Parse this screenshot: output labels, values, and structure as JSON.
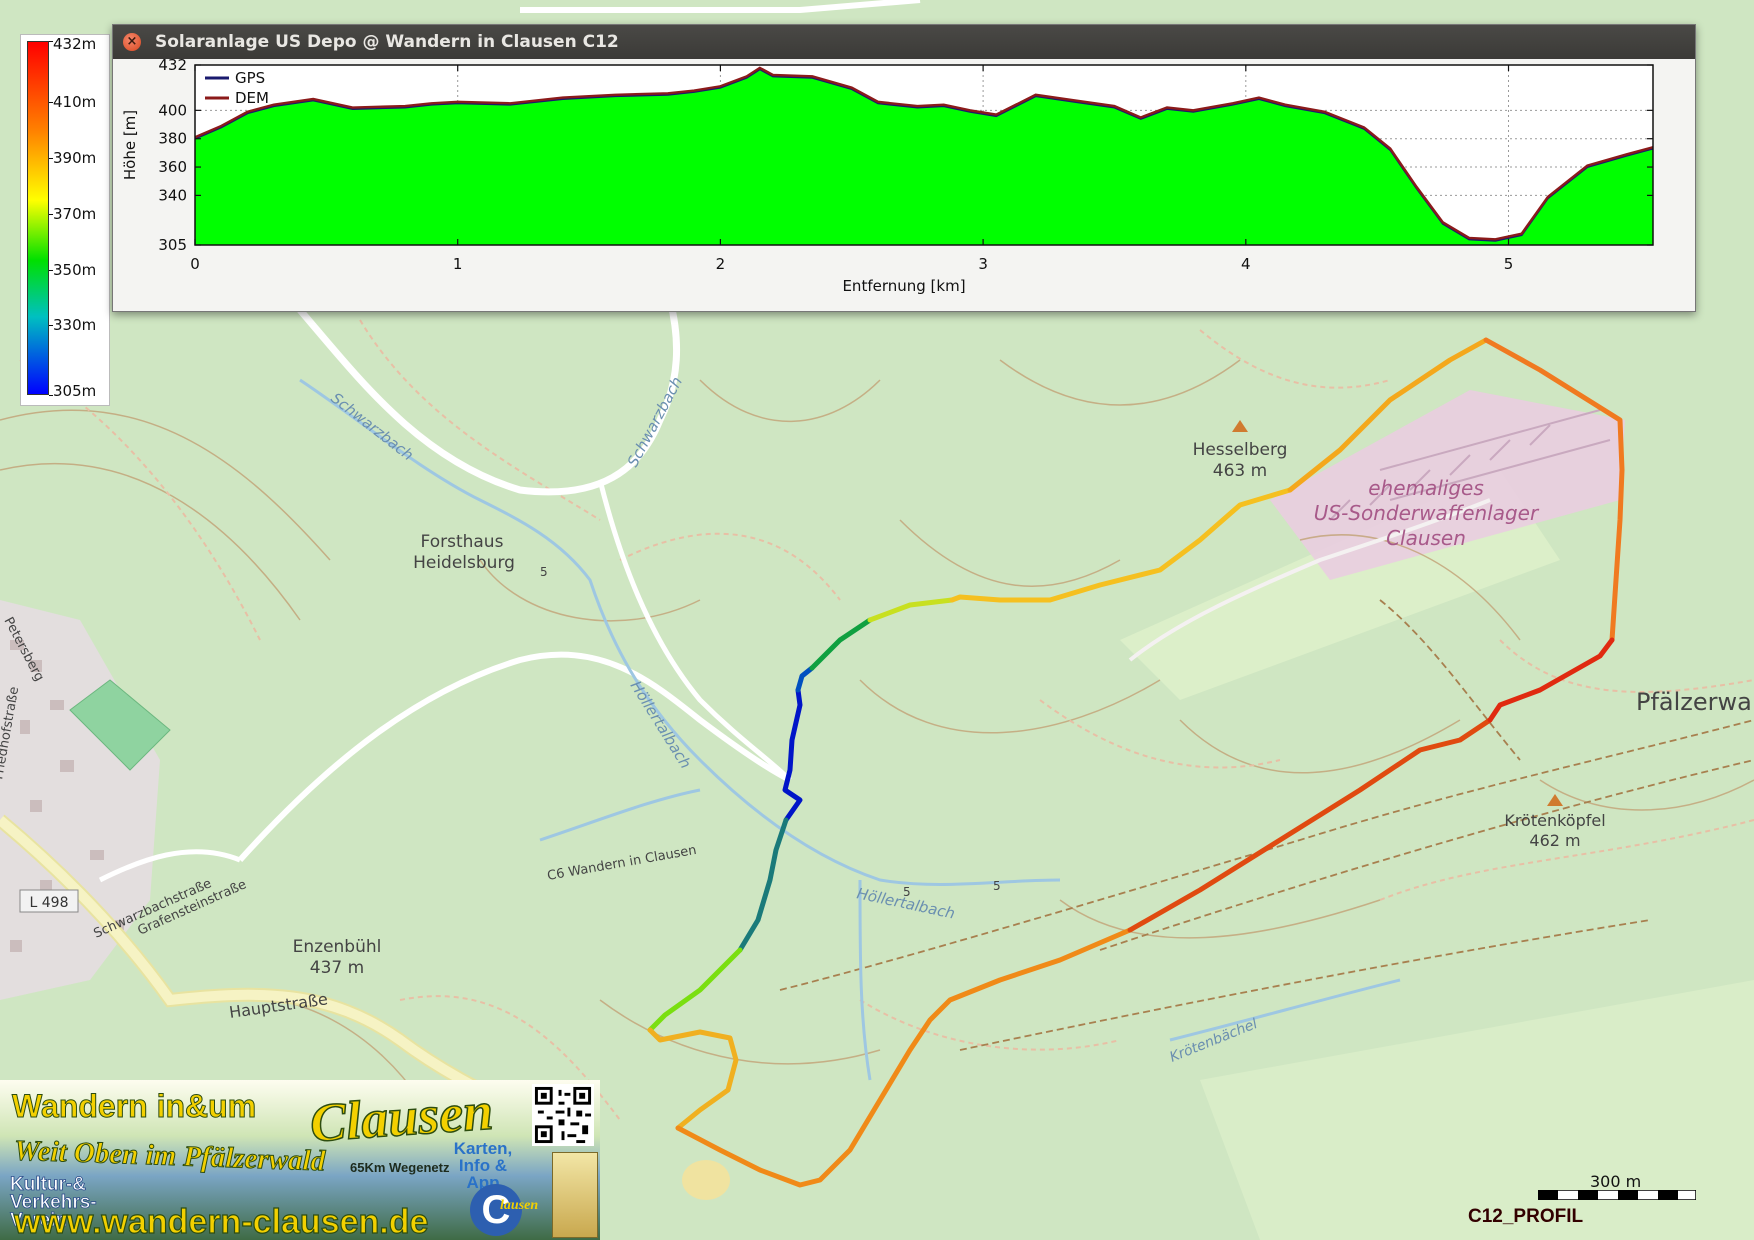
{
  "window": {
    "title": "Solaranlage US Depo @ Wandern in Clausen C12"
  },
  "legend": {
    "labels": [
      "432m",
      "410m",
      "390m",
      "370m",
      "350m",
      "330m",
      "305m"
    ],
    "values": [
      432,
      410,
      390,
      370,
      350,
      330,
      305
    ]
  },
  "chart_data": {
    "type": "area",
    "xlabel": "Entfernung [km]",
    "ylabel": "Höhe [m]",
    "xlim": [
      0,
      5.55
    ],
    "ylim": [
      305,
      432
    ],
    "xticks": [
      0,
      1,
      2,
      3,
      4,
      5
    ],
    "yticks": [
      305,
      340,
      360,
      380,
      400,
      432
    ],
    "grid": true,
    "legend_position": "top-left",
    "fill_color": "#00ff00",
    "series": [
      {
        "name": "GPS",
        "color": "#1a1a6e",
        "x": [
          0,
          0.1,
          0.2,
          0.3,
          0.45,
          0.6,
          0.8,
          0.9,
          1.0,
          1.2,
          1.4,
          1.6,
          1.8,
          1.9,
          2.0,
          2.1,
          2.15,
          2.2,
          2.35,
          2.5,
          2.6,
          2.75,
          2.85,
          2.95,
          3.05,
          3.2,
          3.35,
          3.5,
          3.6,
          3.7,
          3.8,
          3.95,
          4.05,
          4.15,
          4.3,
          4.45,
          4.55,
          4.65,
          4.75,
          4.85,
          4.95,
          5.05,
          5.15,
          5.3,
          5.45,
          5.55
        ],
        "y": [
          380,
          388,
          398,
          403,
          407,
          401,
          402,
          404,
          405,
          404,
          408,
          410,
          411,
          413,
          416,
          423,
          429,
          424,
          423,
          415,
          405,
          402,
          403,
          399,
          396,
          410,
          406,
          402,
          394,
          401,
          399,
          404,
          408,
          403,
          398,
          387,
          372,
          345,
          320,
          309,
          308,
          312,
          338,
          360,
          368,
          373
        ]
      },
      {
        "name": "DEM",
        "color": "#8b1a1a",
        "x": [
          0,
          0.1,
          0.2,
          0.3,
          0.45,
          0.6,
          0.8,
          0.9,
          1.0,
          1.2,
          1.4,
          1.6,
          1.8,
          1.9,
          2.0,
          2.1,
          2.15,
          2.2,
          2.35,
          2.5,
          2.6,
          2.75,
          2.85,
          2.95,
          3.05,
          3.2,
          3.35,
          3.5,
          3.6,
          3.7,
          3.8,
          3.95,
          4.05,
          4.15,
          4.3,
          4.45,
          4.55,
          4.65,
          4.75,
          4.85,
          4.95,
          5.05,
          5.15,
          5.3,
          5.45,
          5.55
        ],
        "y": [
          381,
          389,
          399,
          404,
          408,
          402,
          403,
          405,
          406,
          405,
          409,
          411,
          412,
          414,
          417,
          424,
          430,
          425,
          424,
          416,
          406,
          403,
          404,
          400,
          397,
          411,
          407,
          403,
          395,
          402,
          400,
          405,
          409,
          404,
          399,
          388,
          373,
          346,
          321,
          310,
          309,
          313,
          339,
          361,
          369,
          374
        ]
      }
    ]
  },
  "map": {
    "labels": {
      "forsthaus": "Forsthaus Heidelsburg",
      "hesselberg": "Hesselberg",
      "hesselberg_elev": "463 m",
      "depot_line1": "ehemaliges",
      "depot_line2": "US-Sonderwaffenlager",
      "depot_line3": "Clausen",
      "pfaelzerwald": "Pfälzerwa",
      "kroetenkoepfel": "Krötenköpfel",
      "kroetenkoepfel_elev": "462 m",
      "enzenbuehl": "Enzenbühl",
      "enzenbuehl_elev": "437 m",
      "hauptstrasse": "Hauptstraße",
      "schwarzbachstrasse": "Schwarzbachstraße",
      "grafensteinstrasse": "Grafensteinstraße",
      "friedhofstrasse": "Friedhofstraße",
      "petersberg": "Petersberg",
      "road_l498": "L 498",
      "road_l498_b": "L 498",
      "schwarzbach_1": "Schwarzbach",
      "schwarzbach_2": "Schwarzbach",
      "hoellertalbach_1": "Höllertalbach",
      "hoellertalbach_2": "Höllertalbach",
      "kroetenbachel": "Krötenbächel",
      "c6_route": "C6 Wandern in Clausen",
      "route_marker_5": "5",
      "route_marker_5b": "5",
      "route_marker_5c": "5"
    },
    "scale_label": "300 m",
    "profile_label": "C12_PROFIL"
  },
  "logo": {
    "headline": "Wandern in&um",
    "brand": "Clausen",
    "slogan": "Weit Oben im Pfälzerwald",
    "club": "Kultur-& Verkehrs-Verein",
    "network": "65Km Wegenetz",
    "app": "Karten, Info & App",
    "url": "www.wandern-clausen.de",
    "c_letter": "C",
    "c_script": "lausen"
  }
}
